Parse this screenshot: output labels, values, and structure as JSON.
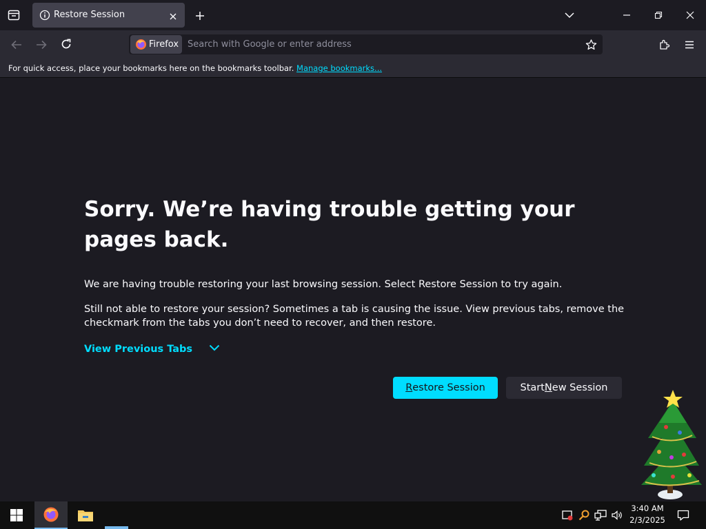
{
  "tab": {
    "title": "Restore Session"
  },
  "urlbar": {
    "identity_label": "Firefox",
    "placeholder": "Search with Google or enter address"
  },
  "bookmarks_bar": {
    "text": "For quick access, place your bookmarks here on the bookmarks toolbar.",
    "link": "Manage bookmarks..."
  },
  "page": {
    "heading": "Sorry. We’re having trouble getting your pages back.",
    "p1": "We are having trouble restoring your last browsing session. Select Restore Session to try again.",
    "p2": "Still not able to restore your session? Sometimes a tab is causing the issue. View previous tabs, remove the checkmark from the tabs you don’t need to recover, and then restore.",
    "view_tabs": "View Previous Tabs",
    "restore_button": {
      "accel": "R",
      "rest": "estore Session"
    },
    "new_button": {
      "pre": "Start ",
      "accel": "N",
      "rest": "ew Session"
    }
  },
  "taskbar": {
    "time": "3:40 AM",
    "date": "2/3/2025"
  },
  "colors": {
    "accent": "#00ddff",
    "bg": "#1c1b22",
    "toolbar": "#2b2a33"
  }
}
